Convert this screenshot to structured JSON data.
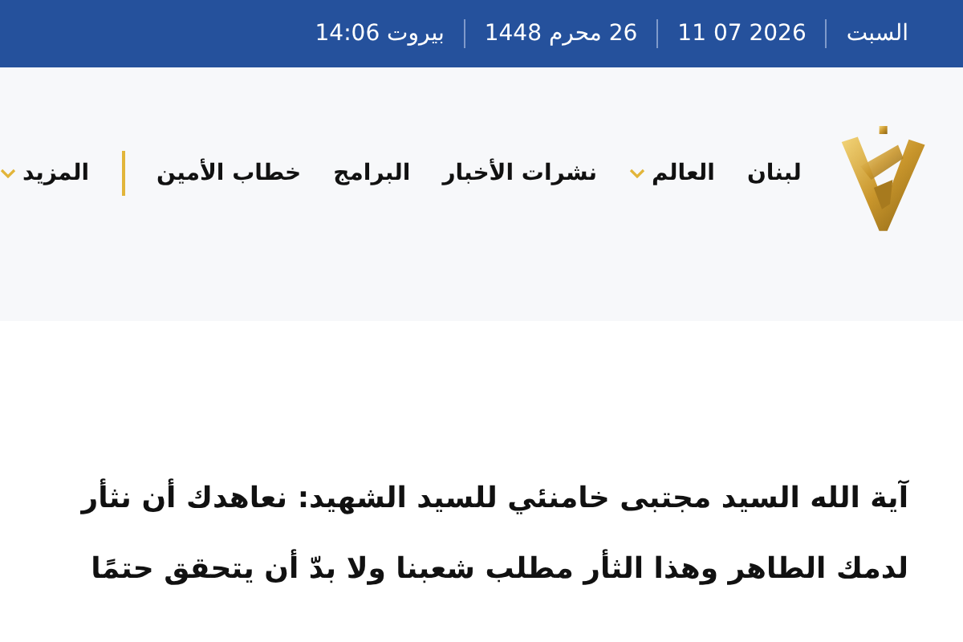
{
  "top_bar": {
    "items": [
      "السبت",
      "2026 07 11",
      "26 محرم 1448",
      "بيروت 14:06"
    ]
  },
  "nav": {
    "items": [
      {
        "label": "لبنان",
        "dropdown": false
      },
      {
        "label": "العالم",
        "dropdown": true
      },
      {
        "label": "نشرات الأخبار",
        "dropdown": false
      },
      {
        "label": "البرامج",
        "dropdown": false
      },
      {
        "label": "خطاب الأمين",
        "dropdown": false
      },
      {
        "label": "المزيد",
        "dropdown": true,
        "divider_before": true
      }
    ]
  },
  "headline": {
    "lines": [
      "آية الله السيد مجتبى خامنئي للسيد الشهيد: نعاهدك أن نثأر",
      "لدمك الطاهر وهذا الثأر مطلب شعبنا ولا بدّ أن يتحقق حتمًا"
    ]
  }
}
